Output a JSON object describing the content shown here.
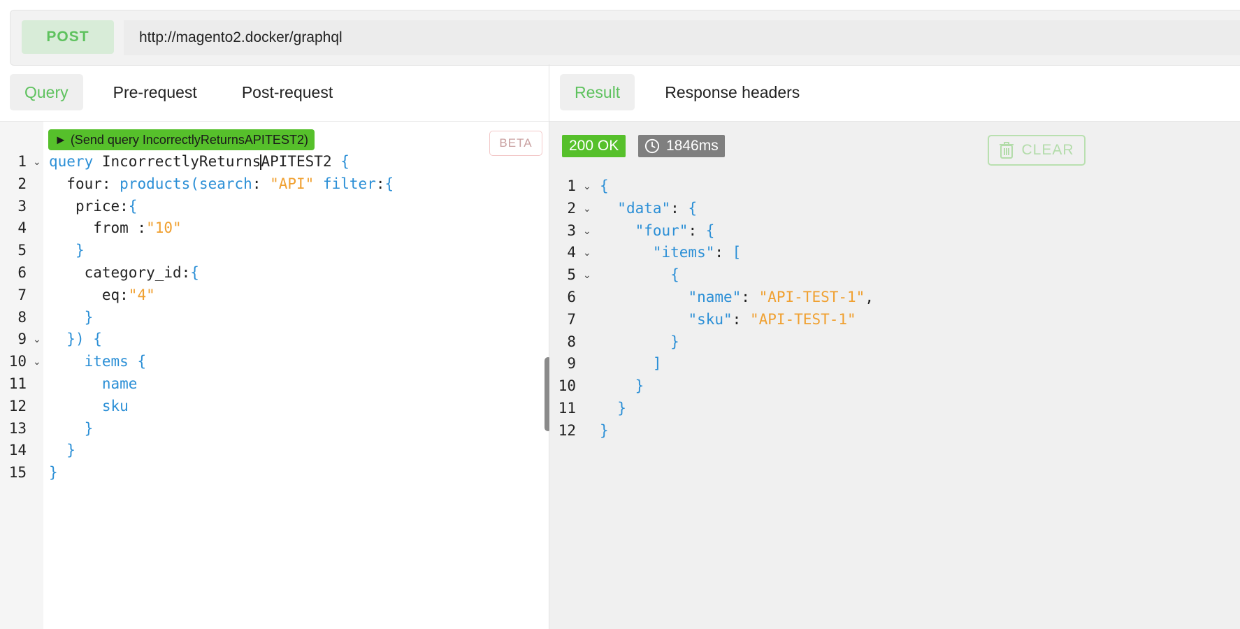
{
  "request": {
    "method": "POST",
    "url": "http://magento2.docker/graphql"
  },
  "left_tabs": [
    {
      "label": "Query",
      "active": true
    },
    {
      "label": "Pre-request",
      "active": false
    },
    {
      "label": "Post-request",
      "active": false
    }
  ],
  "right_tabs": [
    {
      "label": "Result",
      "active": true
    },
    {
      "label": "Response headers",
      "active": false
    }
  ],
  "editor": {
    "run_label": "► (Send query IncorrectlyReturnsAPITEST2)",
    "beta_label": "BETA",
    "line_numbers": [
      "1",
      "2",
      "3",
      "4",
      "5",
      "6",
      "7",
      "8",
      "9",
      "10",
      "11",
      "12",
      "13",
      "14",
      "15"
    ],
    "lines": [
      {
        "indent": "",
        "tokens": [
          [
            "kw",
            "query"
          ],
          [
            "plain",
            " IncorrectlyReturns"
          ],
          [
            "plain",
            "APITEST2 "
          ],
          [
            "br",
            "{"
          ]
        ]
      },
      {
        "indent": "  ",
        "tokens": [
          [
            "plain",
            "four: "
          ],
          [
            "kw",
            "products("
          ],
          [
            "kw",
            "search"
          ],
          [
            "plain",
            ": "
          ],
          [
            "str",
            "\"API\""
          ],
          [
            "plain",
            " "
          ],
          [
            "kw",
            "filter"
          ],
          [
            "plain",
            ":"
          ],
          [
            "br",
            "{"
          ]
        ]
      },
      {
        "indent": "   ",
        "tokens": [
          [
            "plain",
            "price:"
          ],
          [
            "br",
            "{"
          ]
        ]
      },
      {
        "indent": "     ",
        "tokens": [
          [
            "plain",
            "from :"
          ],
          [
            "str",
            "\"10\""
          ]
        ]
      },
      {
        "indent": "   ",
        "tokens": [
          [
            "br",
            "}"
          ]
        ]
      },
      {
        "indent": "    ",
        "tokens": [
          [
            "plain",
            "category_id:"
          ],
          [
            "br",
            "{"
          ]
        ]
      },
      {
        "indent": "      ",
        "tokens": [
          [
            "plain",
            "eq:"
          ],
          [
            "str",
            "\"4\""
          ]
        ]
      },
      {
        "indent": "    ",
        "tokens": [
          [
            "br",
            "}"
          ]
        ]
      },
      {
        "indent": "  ",
        "tokens": [
          [
            "br",
            "}) {"
          ]
        ]
      },
      {
        "indent": "    ",
        "tokens": [
          [
            "kw",
            "items "
          ],
          [
            "br",
            "{"
          ]
        ]
      },
      {
        "indent": "      ",
        "tokens": [
          [
            "kw",
            "name"
          ]
        ]
      },
      {
        "indent": "      ",
        "tokens": [
          [
            "kw",
            "sku"
          ]
        ]
      },
      {
        "indent": "    ",
        "tokens": [
          [
            "br",
            "}"
          ]
        ]
      },
      {
        "indent": "  ",
        "tokens": [
          [
            "br",
            "}"
          ]
        ]
      },
      {
        "indent": "",
        "tokens": [
          [
            "br",
            "}"
          ]
        ]
      }
    ],
    "fold_lines": [
      1,
      9,
      10
    ]
  },
  "result": {
    "status": "200 OK",
    "time": "1846ms",
    "clear_label": "CLEAR",
    "line_numbers": [
      "1",
      "2",
      "3",
      "4",
      "5",
      "6",
      "7",
      "8",
      "9",
      "10",
      "11",
      "12"
    ],
    "lines": [
      {
        "indent": "",
        "tokens": [
          [
            "br",
            "{"
          ]
        ]
      },
      {
        "indent": "  ",
        "tokens": [
          [
            "kw",
            "\"data\""
          ],
          [
            "plain",
            ": "
          ],
          [
            "br",
            "{"
          ]
        ]
      },
      {
        "indent": "    ",
        "tokens": [
          [
            "kw",
            "\"four\""
          ],
          [
            "plain",
            ": "
          ],
          [
            "br",
            "{"
          ]
        ]
      },
      {
        "indent": "      ",
        "tokens": [
          [
            "kw",
            "\"items\""
          ],
          [
            "plain",
            ": "
          ],
          [
            "br",
            "["
          ]
        ]
      },
      {
        "indent": "        ",
        "tokens": [
          [
            "br",
            "{"
          ]
        ]
      },
      {
        "indent": "          ",
        "tokens": [
          [
            "kw",
            "\"name\""
          ],
          [
            "plain",
            ": "
          ],
          [
            "str",
            "\"API-TEST-1\""
          ],
          [
            "plain",
            ","
          ]
        ]
      },
      {
        "indent": "          ",
        "tokens": [
          [
            "kw",
            "\"sku\""
          ],
          [
            "plain",
            ": "
          ],
          [
            "str",
            "\"API-TEST-1\""
          ]
        ]
      },
      {
        "indent": "        ",
        "tokens": [
          [
            "br",
            "}"
          ]
        ]
      },
      {
        "indent": "      ",
        "tokens": [
          [
            "br",
            "]"
          ]
        ]
      },
      {
        "indent": "    ",
        "tokens": [
          [
            "br",
            "}"
          ]
        ]
      },
      {
        "indent": "  ",
        "tokens": [
          [
            "br",
            "}"
          ]
        ]
      },
      {
        "indent": "",
        "tokens": [
          [
            "br",
            "}"
          ]
        ]
      }
    ],
    "fold_lines": [
      1,
      2,
      3,
      4,
      5
    ]
  },
  "colors": {
    "accent_green": "#5ec25e",
    "keyword_blue": "#2b8fd6",
    "string_orange": "#f0a030"
  }
}
